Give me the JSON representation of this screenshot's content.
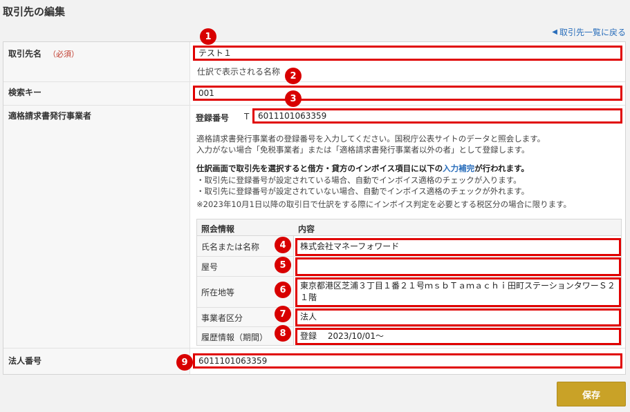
{
  "page": {
    "title": "取引先の編集",
    "back_link": "取引先一覧に戻る"
  },
  "fields": {
    "partner_name": {
      "label": "取引先名",
      "required": "（必須）",
      "value": "テスト１",
      "hint": "仕訳で表示される名称"
    },
    "search_key": {
      "label": "検索キー",
      "value": "001"
    },
    "invoice_issuer": {
      "label": "適格請求書発行事業者",
      "reg_label": "登録番号",
      "prefix": "T",
      "value": "6011101063359",
      "desc1": "適格請求書発行事業者の登録番号を入力してください。国税庁公表サイトのデータと照会します。",
      "desc2": "入力がない場合「免税事業者」または「適格請求書発行事業者以外の者」として登録します。",
      "bold_pre": "仕訳画面で取引先を選択すると借方・貸方のインボイス項目に以下の",
      "bold_link": "入力補完",
      "bold_post": "が行われます。",
      "bullet1": "・取引先に登録番号が設定されている場合、自動でインボイス適格のチェックが入ります。",
      "bullet2": "・取引先に登録番号が設定されていない場合、自動でインボイス適格のチェックが外れます。",
      "note": "※2023年10月1日以降の取引日で仕訳をする際にインボイス判定を必要とする税区分の場合に限ります。"
    },
    "corporate_number": {
      "label": "法人番号",
      "value": "6011101063359"
    }
  },
  "info_table": {
    "headers": [
      "照会情報",
      "内容"
    ],
    "rows": [
      {
        "label": "氏名または名称",
        "value": "株式会社マネーフォワード"
      },
      {
        "label": "屋号",
        "value": ""
      },
      {
        "label": "所在地等",
        "value": "東京都港区芝浦３丁目１番２１号ｍｓｂＴａｍａｃｈｉ田町ステーションタワーＳ２１階"
      },
      {
        "label": "事業者区分",
        "value": "法人"
      },
      {
        "label": "履歴情報（期間）",
        "value": "登録　 2023/10/01〜"
      }
    ]
  },
  "badges": [
    "1",
    "2",
    "3",
    "4",
    "5",
    "6",
    "7",
    "8",
    "9"
  ],
  "buttons": {
    "save": "保存"
  },
  "colors": {
    "accent": "#c9a227",
    "highlight": "#e00000",
    "link": "#2a6ebb"
  }
}
